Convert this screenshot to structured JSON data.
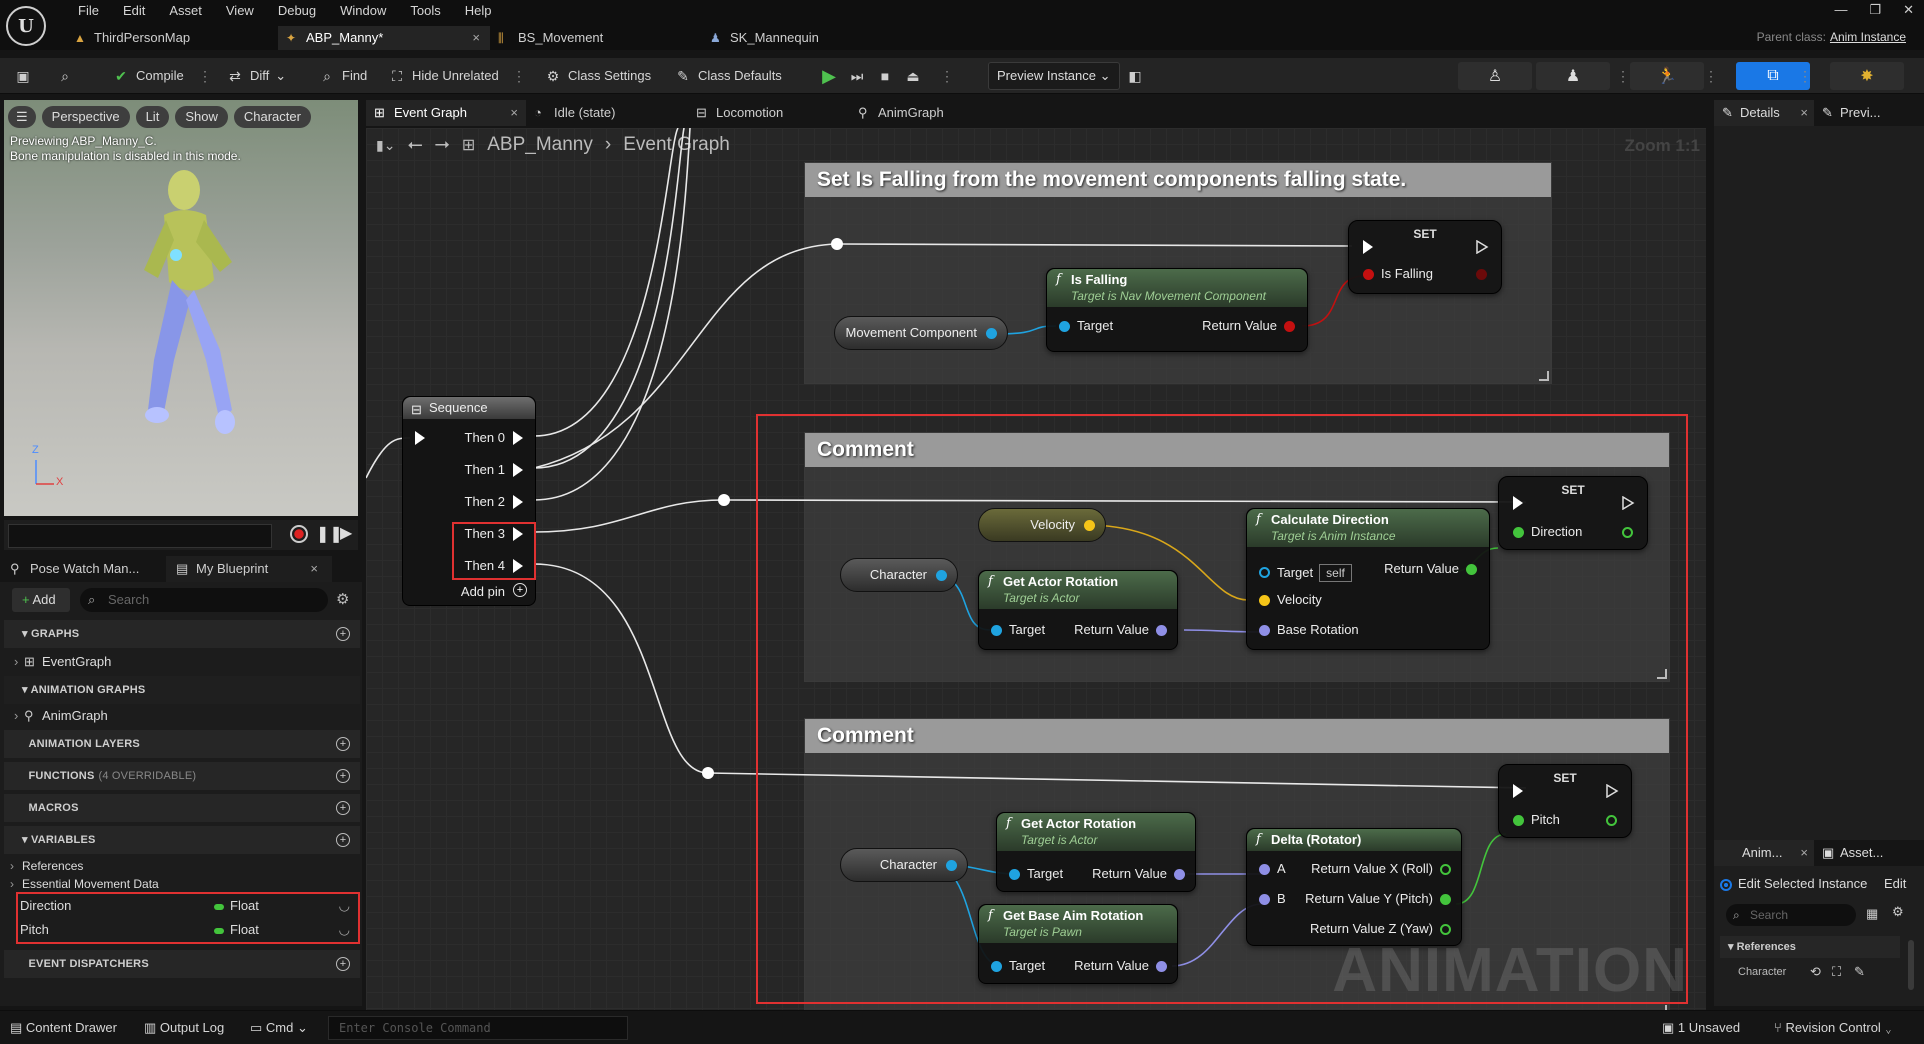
{
  "menu": [
    "File",
    "Edit",
    "Asset",
    "View",
    "Debug",
    "Window",
    "Tools",
    "Help"
  ],
  "doc_tabs": [
    {
      "label": "ThirdPersonMap",
      "active": false
    },
    {
      "label": "ABP_Manny*",
      "active": true
    },
    {
      "label": "BS_Movement",
      "active": false
    },
    {
      "label": "SK_Mannequin",
      "active": false
    }
  ],
  "parent_class": {
    "label": "Parent class:",
    "value": "Anim Instance"
  },
  "toolbar": {
    "compile": "Compile",
    "diff": "Diff",
    "find": "Find",
    "hide_unrelated": "Hide Unrelated",
    "class_settings": "Class Settings",
    "class_defaults": "Class Defaults",
    "preview_instance": "Preview Instance"
  },
  "viewport": {
    "chips": [
      "Perspective",
      "Lit",
      "Show",
      "Character"
    ],
    "info_line1": "Previewing ABP_Manny_C.",
    "info_line2": "Bone manipulation is disabled in this mode.",
    "axis_z": "Z",
    "axis_x": "X"
  },
  "left_tabs": [
    "Pose Watch Man...",
    "My Blueprint"
  ],
  "myblueprint": {
    "add_label": "Add",
    "search_placeholder": "Search",
    "graphs_header": "GRAPHS",
    "event_graph": "EventGraph",
    "anim_graphs_header": "ANIMATION GRAPHS",
    "anim_graph": "AnimGraph",
    "anim_layers_header": "ANIMATION LAYERS",
    "functions_header": "FUNCTIONS",
    "functions_sub": "(4 OVERRIDABLE)",
    "macros_header": "MACROS",
    "variables_header": "VARIABLES",
    "references": "References",
    "essential": "Essential Movement Data",
    "variables": [
      {
        "name": "Direction",
        "type": "Float"
      },
      {
        "name": "Pitch",
        "type": "Float"
      }
    ],
    "dispatchers_header": "EVENT DISPATCHERS"
  },
  "graph_tabs": [
    {
      "label": "Event Graph",
      "active": true
    },
    {
      "label": "Idle (state)",
      "active": false
    },
    {
      "label": "Locomotion",
      "active": false
    },
    {
      "label": "AnimGraph",
      "active": false
    }
  ],
  "breadcrumb": {
    "asset": "ABP_Manny",
    "graph": "Event Graph"
  },
  "zoom": "Zoom 1:1",
  "watermark": "ANIMATION",
  "comments": {
    "top": "Set Is Falling from the movement components falling state.",
    "mid": "Comment",
    "bottom": "Comment"
  },
  "nodes": {
    "sequence": {
      "title": "Sequence",
      "pins": [
        "Then 0",
        "Then 1",
        "Then 2",
        "Then 3",
        "Then 4"
      ],
      "add_pin": "Add pin"
    },
    "movement_component": "Movement Component",
    "is_falling": {
      "title": "Is Falling",
      "sub": "Target is Nav Movement Component",
      "target": "Target",
      "ret": "Return Value"
    },
    "set1": {
      "title": "SET",
      "pin": "Is Falling"
    },
    "velocity": "Velocity",
    "character1": "Character",
    "get_actor_rotation1": {
      "title": "Get Actor Rotation",
      "sub": "Target is Actor",
      "target": "Target",
      "ret": "Return Value"
    },
    "calc_direction": {
      "title": "Calculate Direction",
      "sub": "Target is Anim Instance",
      "target": "Target",
      "self": "self",
      "ret": "Return Value",
      "velocity": "Velocity",
      "base_rotation": "Base Rotation"
    },
    "set2": {
      "title": "SET",
      "pin": "Direction"
    },
    "character2": "Character",
    "get_actor_rotation2": {
      "title": "Get Actor Rotation",
      "sub": "Target is Actor",
      "target": "Target",
      "ret": "Return Value"
    },
    "get_base_aim": {
      "title": "Get Base Aim Rotation",
      "sub": "Target is Pawn",
      "target": "Target",
      "ret": "Return Value"
    },
    "delta": {
      "title": "Delta (Rotator)",
      "a": "A",
      "b": "B",
      "x": "Return Value X (Roll)",
      "y": "Return Value Y (Pitch)",
      "z": "Return Value Z (Yaw)"
    },
    "set3": {
      "title": "SET",
      "pin": "Pitch"
    }
  },
  "right_tabs": [
    "Details",
    "Previ..."
  ],
  "right2_tabs": [
    "Anim...",
    "Asset..."
  ],
  "right2": {
    "edit_selected": "Edit Selected Instance",
    "edit": "Edit",
    "search_placeholder": "Search",
    "references": "References",
    "character": "Character"
  },
  "statusbar": {
    "content_drawer": "Content Drawer",
    "output_log": "Output Log",
    "cmd": "Cmd",
    "console_placeholder": "Enter Console Command",
    "unsaved": "1 Unsaved",
    "revision": "Revision Control"
  },
  "colors": {
    "accent": "#1a78e6",
    "highlight": "#e03131",
    "float_pin": "#43c43c",
    "object_pin": "#1fa3e0",
    "bool_pin": "#c41010",
    "vector_pin": "#f5c518",
    "rotator_pin": "#8f8fe6"
  }
}
